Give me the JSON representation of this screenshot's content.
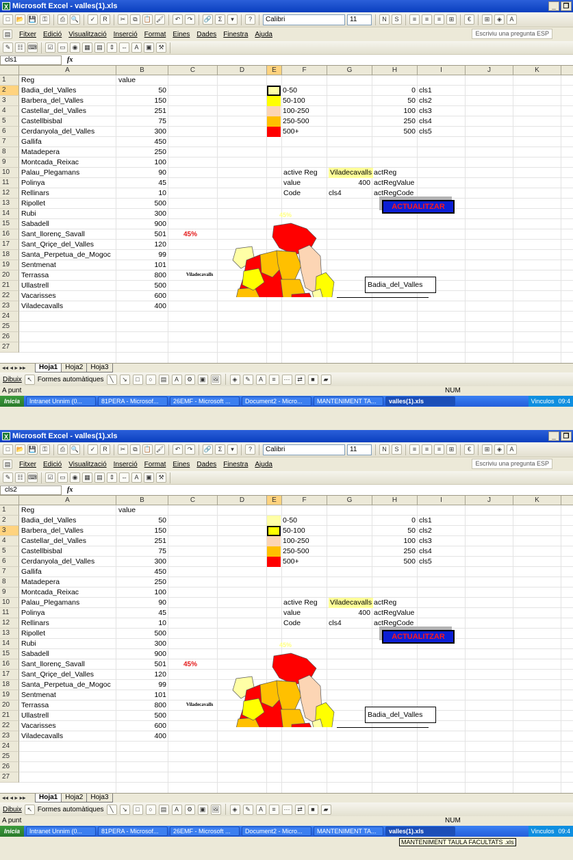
{
  "app_title": "Microsoft Excel - valles(1).xls",
  "menu": [
    "Fitxer",
    "Edició",
    "Visualització",
    "Inserció",
    "Format",
    "Eines",
    "Dades",
    "Finestra",
    "Ajuda"
  ],
  "help_placeholder": "Escriviu una pregunta ESP",
  "font_name": "Calibri",
  "font_size": "11",
  "fx_label": "fx",
  "columns": [
    "A",
    "B",
    "C",
    "D",
    "E",
    "F",
    "G",
    "H",
    "I",
    "J",
    "K",
    "L"
  ],
  "header_reg": "Reg",
  "header_value": "value",
  "regions": [
    {
      "name": "Badia_del_Valles",
      "value": "50"
    },
    {
      "name": "Barbera_del_Valles",
      "value": "150"
    },
    {
      "name": "Castellar_del_Valles",
      "value": "251"
    },
    {
      "name": "Castellbisbal",
      "value": "75"
    },
    {
      "name": "Cerdanyola_del_Valles",
      "value": "300"
    },
    {
      "name": "Gallifa",
      "value": "450"
    },
    {
      "name": "Matadepera",
      "value": "250"
    },
    {
      "name": "Montcada_Reixac",
      "value": "100"
    },
    {
      "name": "Palau_Plegamans",
      "value": "90"
    },
    {
      "name": "Polinya",
      "value": "45"
    },
    {
      "name": "Rellinars",
      "value": "10"
    },
    {
      "name": "Ripollet",
      "value": "500"
    },
    {
      "name": "Rubi",
      "value": "300"
    },
    {
      "name": "Sabadell",
      "value": "900"
    },
    {
      "name": "Sant_llorenç_Savall",
      "value": "501"
    },
    {
      "name": "Sant_Qriçe_del_Valles",
      "value": "120"
    },
    {
      "name": "Santa_Perpetua_de_Mogoc",
      "value": "99"
    },
    {
      "name": "Sentmenat",
      "value": "101"
    },
    {
      "name": "Terrassa",
      "value": "800"
    },
    {
      "name": "Ullastrell",
      "value": "500"
    },
    {
      "name": "Vacarisses",
      "value": "600"
    },
    {
      "name": "Viladecavalls",
      "value": "400"
    }
  ],
  "legend": [
    {
      "range": "0-50",
      "min": "0",
      "cls": "cls1",
      "color": "#ffffa6"
    },
    {
      "range": "50-100",
      "min": "50",
      "cls": "cls2",
      "color": "#ffff00"
    },
    {
      "range": "100-250",
      "min": "100",
      "cls": "cls3",
      "color": "#fcd5b4"
    },
    {
      "range": "250-500",
      "min": "250",
      "cls": "cls4",
      "color": "#ffc000"
    },
    {
      "range": "500+",
      "min": "500",
      "cls": "cls5",
      "color": "#ff0000"
    }
  ],
  "active": {
    "reg_label": "active Reg",
    "reg_value": "Viladecavalls",
    "reg_name": "actReg",
    "value_label": "value",
    "value_value": "400",
    "value_name": "actRegValue",
    "code_label": "Code",
    "code_value": "cls4",
    "code_name": "actRegCode"
  },
  "button_label": "ACTUALITZAR",
  "pct_label": "45%",
  "map_label": "Viladecavalls",
  "callout_text": "Badia_del_Valles",
  "sheet_tabs": [
    "Hoja1",
    "Hoja2",
    "Hoja3"
  ],
  "draw_label": "Dibuix",
  "autoshapes_label": "Formes automàtiques",
  "status_ready": "A punt",
  "status_num": "NUM",
  "start_label": "Inicia",
  "tasks": [
    "Intranet Unnim (0...",
    "81PERA - Microsof...",
    "26EMF - Microsoft ...",
    "Document2 - Micro...",
    "MANTENIMENT TA...",
    "valles(1).xls"
  ],
  "tray": "Vinculos",
  "clock": "09:4",
  "windows": [
    {
      "namebox": "cls1",
      "selected_row": 2
    },
    {
      "namebox": "cls2",
      "selected_row": 3
    }
  ],
  "tooltip_text": "MANTENIMENT TAULA FACULTATS .xls",
  "map_colors": {
    "red": "#ff0000",
    "orange": "#ffc000",
    "yellow": "#ffff00",
    "light": "#ffffa6",
    "peach": "#fcd5b4"
  }
}
